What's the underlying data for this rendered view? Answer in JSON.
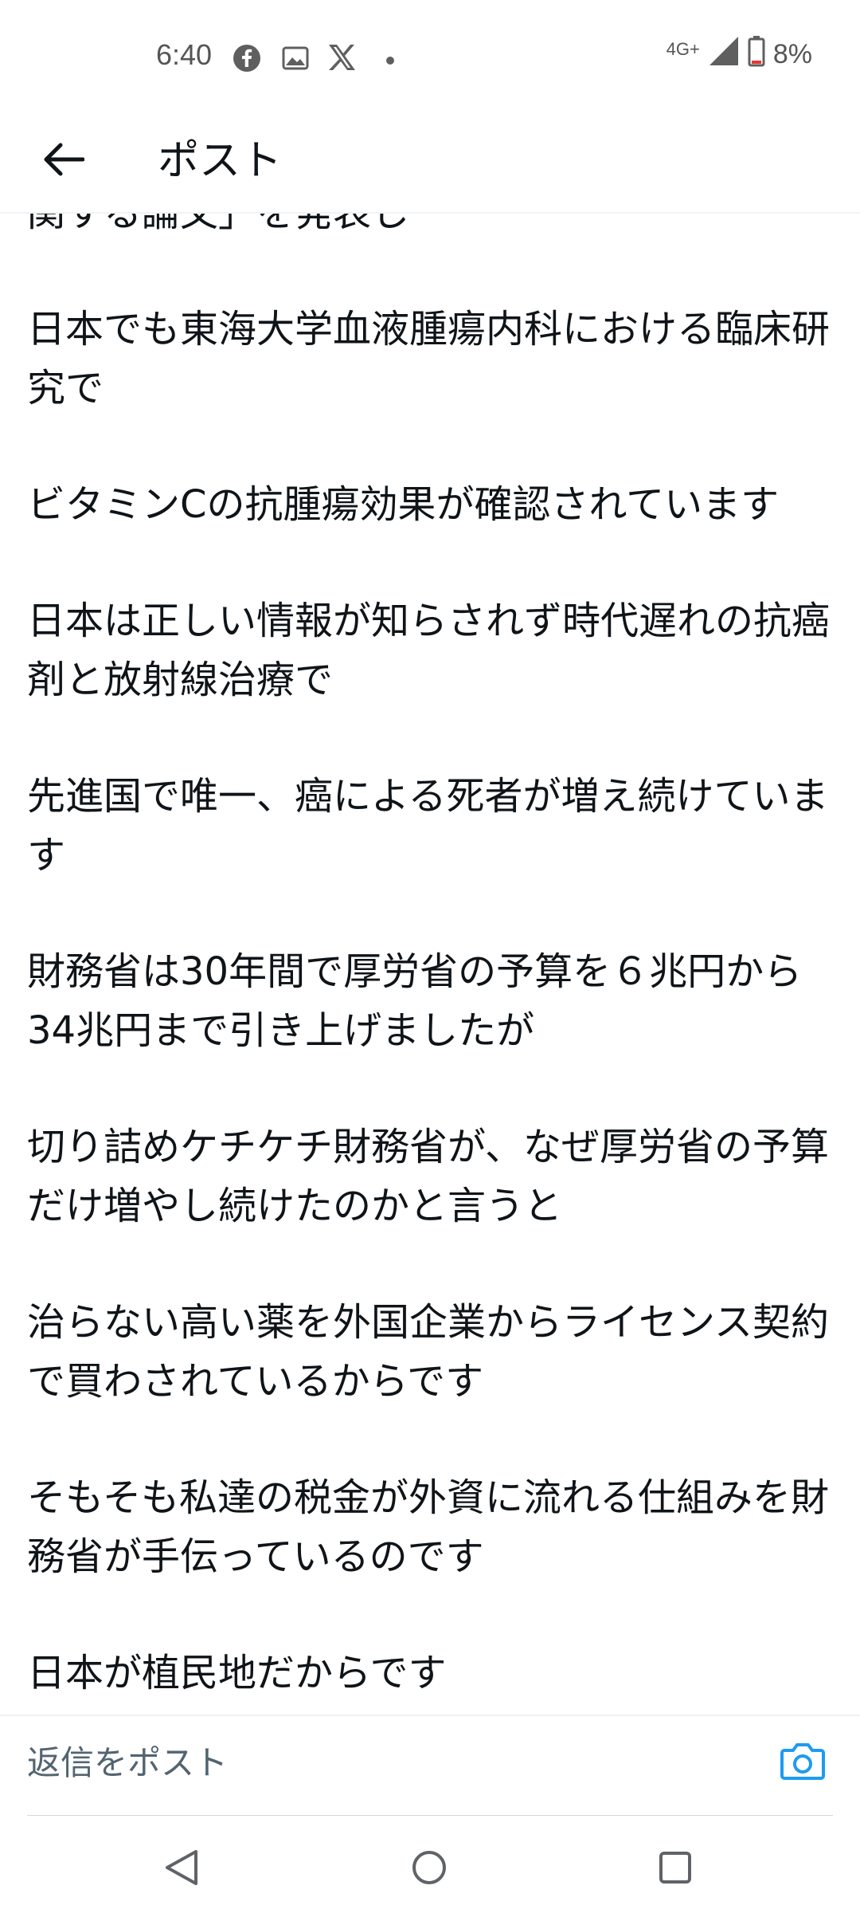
{
  "status_bar": {
    "time": "6:40",
    "icons": [
      "facebook-icon",
      "image-icon",
      "x-icon",
      "dot-icon"
    ],
    "network": "4G+",
    "battery": "8%",
    "battery_color": "#e53935"
  },
  "header": {
    "title": "ポスト"
  },
  "post": {
    "paragraphs": [
      "関する論文」を発表し",
      "日本でも東海大学血液腫瘍内科における臨床研究で",
      "ビタミンCの抗腫瘍効果が確認されています",
      "日本は正しい情報が知らされず時代遅れの抗癌剤と放射線治療で",
      "先進国で唯一、癌による死者が増え続けています",
      "財務省は30年間で厚労省の予算を６兆円から34兆円まで引き上げましたが",
      "切り詰めケチケチ財務省が、なぜ厚労省の予算だけ増やし続けたのかと言うと",
      "治らない高い薬を外国企業からライセンス契約で買わされているからです",
      "そもそも私達の税金が外資に流れる仕組みを財務省が手伝っているのです",
      "日本が植民地だからです"
    ]
  },
  "reply": {
    "placeholder": "返信をポスト",
    "accent_color": "#1d9bf0"
  },
  "nav": {
    "buttons": [
      "back-nav-icon",
      "home-nav-icon",
      "recents-nav-icon"
    ]
  }
}
